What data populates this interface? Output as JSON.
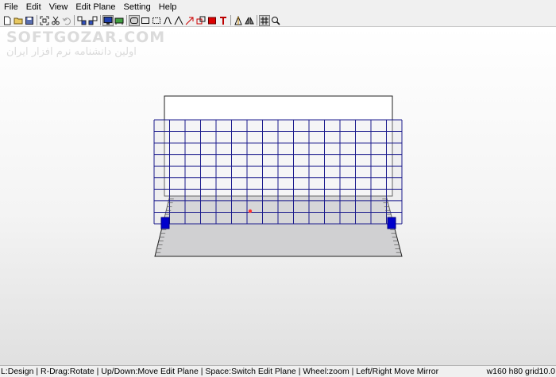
{
  "menu": [
    "File",
    "Edit",
    "View",
    "Edit Plane",
    "Setting",
    "Help"
  ],
  "toolbar": {
    "groups": [
      [
        "new-icon",
        "open-icon",
        "save-icon"
      ],
      [
        "fit-view-icon",
        "cut-icon",
        "undo-icon"
      ],
      [
        "plane-1-icon",
        "plane-2-icon"
      ],
      [
        "monitor-view-icon",
        "table-view-icon"
      ],
      [
        "round-rect-icon",
        "rect-icon",
        "dashed-rect-icon",
        "curve-icon",
        "peak-icon",
        "arrow-icon",
        "multi-rect-icon",
        "red-rect-icon",
        "text-tool-icon"
      ],
      [
        "ruler-icon",
        "mirror-icon"
      ],
      [
        "snap-grid-icon",
        "zoom-icon"
      ]
    ]
  },
  "watermark": {
    "brand": "SOFTGOZAR.COM",
    "tagline": "اولین دانشنامه نرم افزار ایران"
  },
  "status": {
    "left": "L:Design | R-Drag:Rotate | Up/Down:Move Edit Plane | Space:Switch Edit Plane | Wheel:zoom | Left/Right Move Mirror",
    "right": "w160 h80 grid10.0"
  },
  "colors": {
    "grid": "#1a1a8c",
    "handle": "#0000cc",
    "origin": "#ff0000"
  }
}
